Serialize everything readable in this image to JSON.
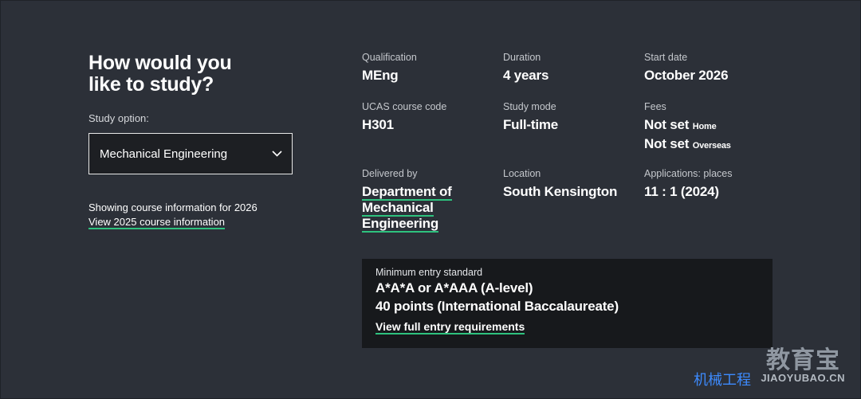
{
  "heading": "How would you like to study?",
  "study_option": {
    "label": "Study option:",
    "selected": "Mechanical Engineering"
  },
  "showing": {
    "text": "Showing course information for 2026",
    "link": "View 2025 course information"
  },
  "details": {
    "qualification": {
      "label": "Qualification",
      "value": "MEng"
    },
    "duration": {
      "label": "Duration",
      "value": "4 years"
    },
    "start_date": {
      "label": "Start date",
      "value": "October 2026"
    },
    "ucas": {
      "label": "UCAS course code",
      "value": "H301"
    },
    "study_mode": {
      "label": "Study mode",
      "value": "Full-time"
    },
    "fees": {
      "label": "Fees",
      "home_value": "Not set",
      "home_tag": "Home",
      "overseas_value": "Not set",
      "overseas_tag": "Overseas"
    },
    "delivered_by": {
      "label": "Delivered by",
      "value": "Department of Mechanical Engineering"
    },
    "location": {
      "label": "Location",
      "value": "South Kensington"
    },
    "applications": {
      "label": "Applications: places",
      "value": "11 : 1 (2024)"
    }
  },
  "entry": {
    "label": "Minimum entry standard",
    "alevel": "A*A*A or A*AAA (A-level)",
    "ib": "40 points (International Baccalaureate)",
    "link": "View full entry requirements"
  },
  "watermark": {
    "big": "教育宝",
    "small": "机械工程",
    "domain": "JIAOYUBAO.CN"
  }
}
